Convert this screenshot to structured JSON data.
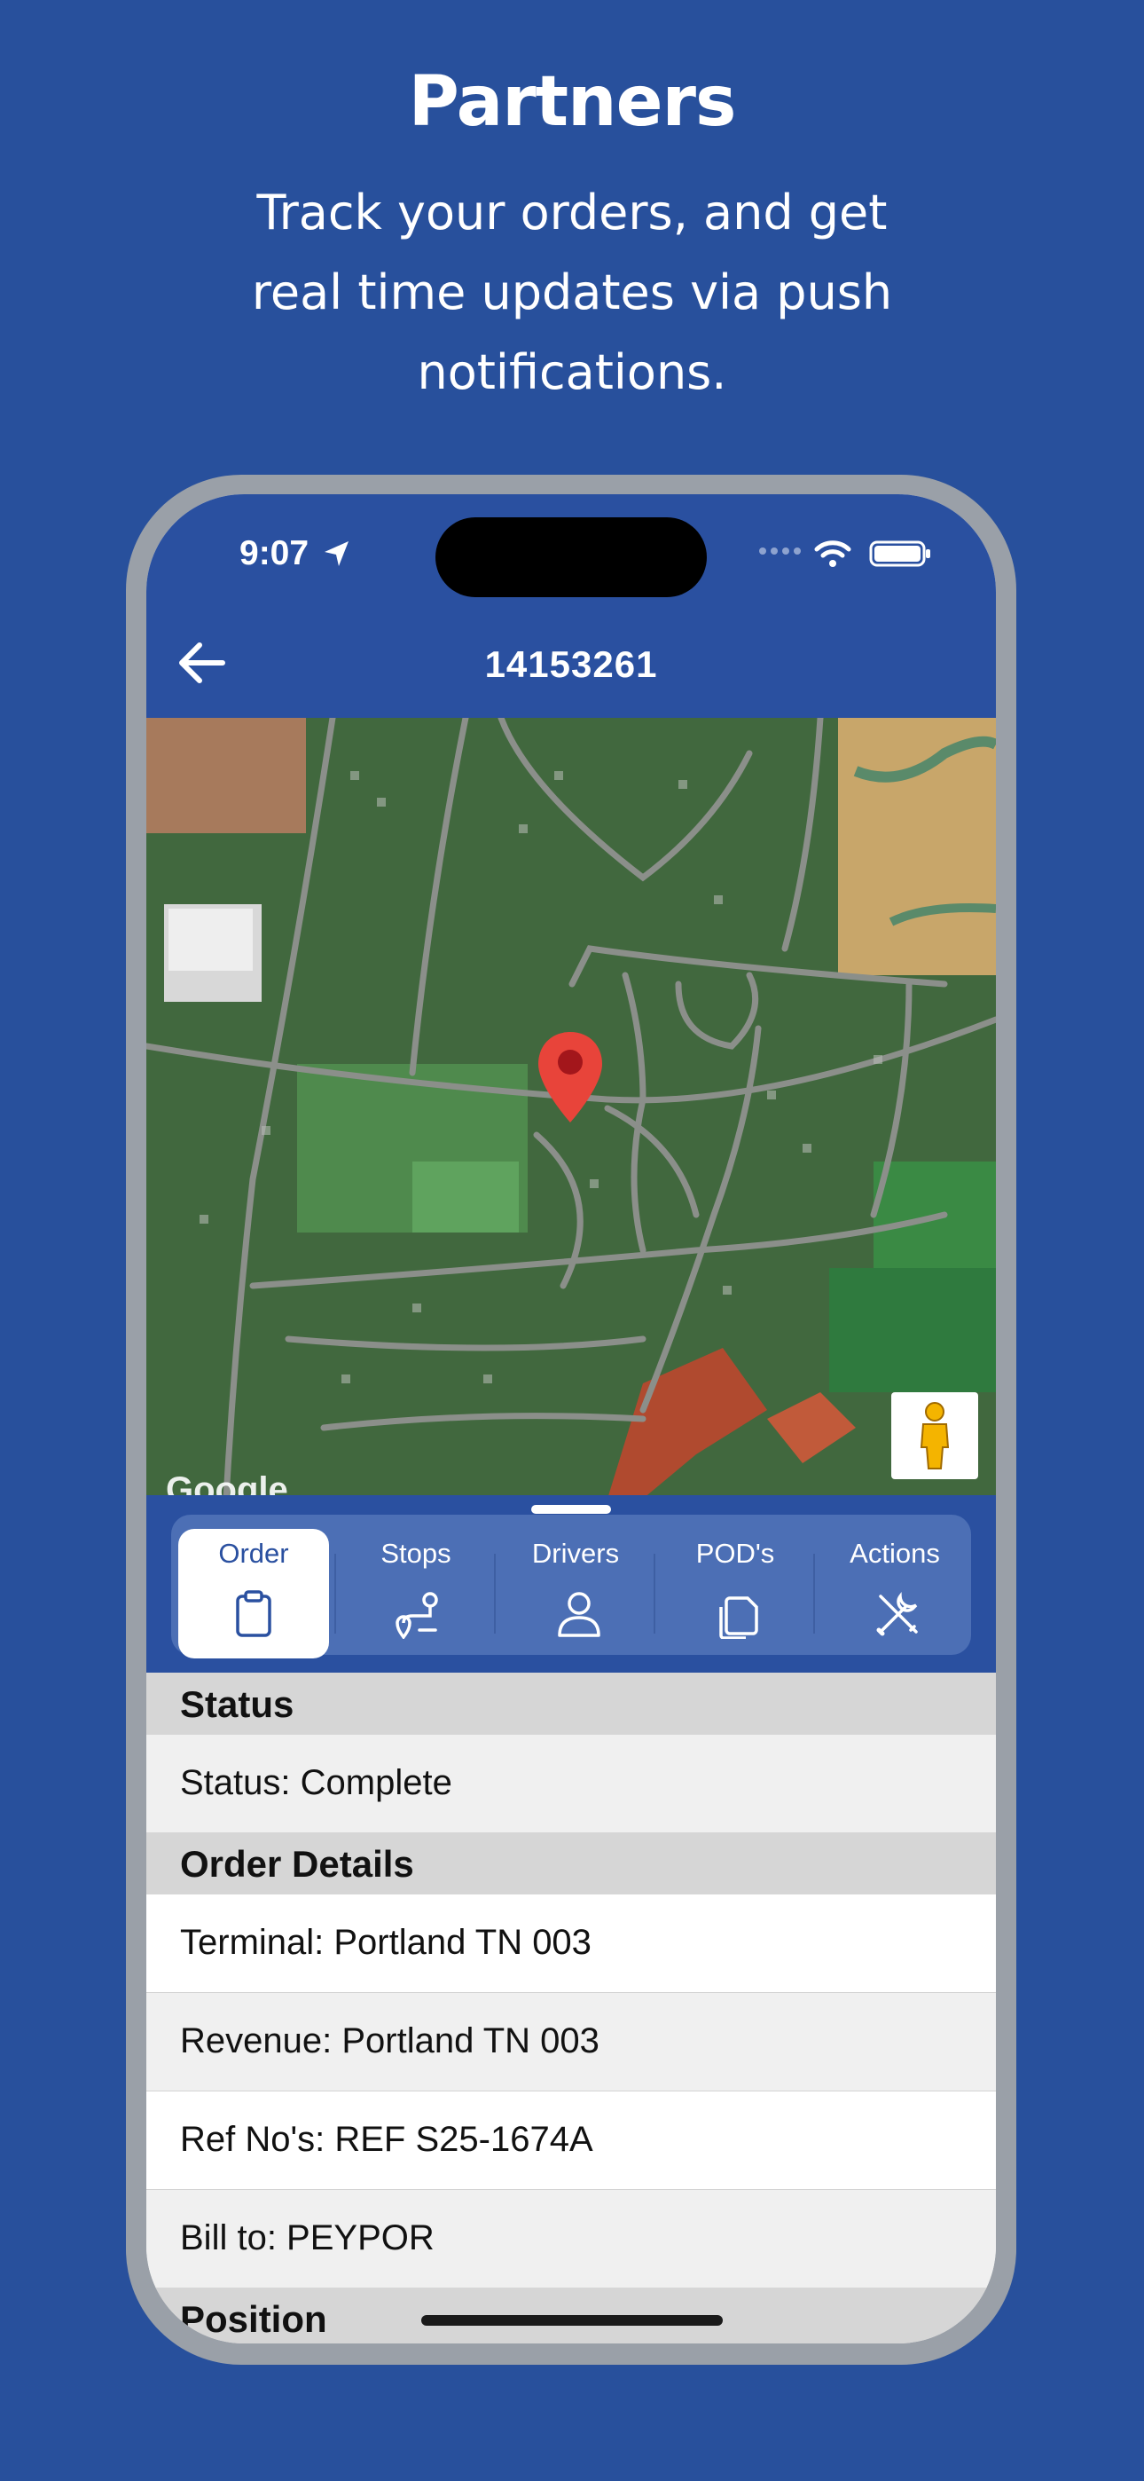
{
  "promo": {
    "headline": "Partners",
    "subline": "Track your orders, and get real time updates via push notifications.",
    "background_color": "#28509c"
  },
  "status_bar": {
    "time": "9:07"
  },
  "nav": {
    "title": "14153261",
    "back_icon": "arrow-left-icon"
  },
  "map": {
    "marker_icon": "map-pin-icon",
    "pegman_icon": "street-view-pegman-icon",
    "attribution": "Google"
  },
  "tabs": [
    {
      "label": "Order",
      "icon": "clipboard-icon",
      "active": true
    },
    {
      "label": "Stops",
      "icon": "route-icon",
      "active": false
    },
    {
      "label": "Drivers",
      "icon": "person-icon",
      "active": false
    },
    {
      "label": "POD's",
      "icon": "documents-icon",
      "active": false
    },
    {
      "label": "Actions",
      "icon": "tools-icon",
      "active": false
    }
  ],
  "sections": {
    "status": {
      "header": "Status",
      "rows": [
        "Status: Complete"
      ]
    },
    "order_details": {
      "header": "Order Details",
      "rows": [
        "Terminal: Portland TN 003",
        "Revenue: Portland TN 003",
        "Ref No's: REF S25-1674A",
        "Bill to: PEYPOR"
      ]
    },
    "position": {
      "header": "Position"
    }
  },
  "colors": {
    "brand_blue": "#2a50a0",
    "tabbar_blue": "#4c6fb5",
    "marker_red": "#e8443a"
  }
}
